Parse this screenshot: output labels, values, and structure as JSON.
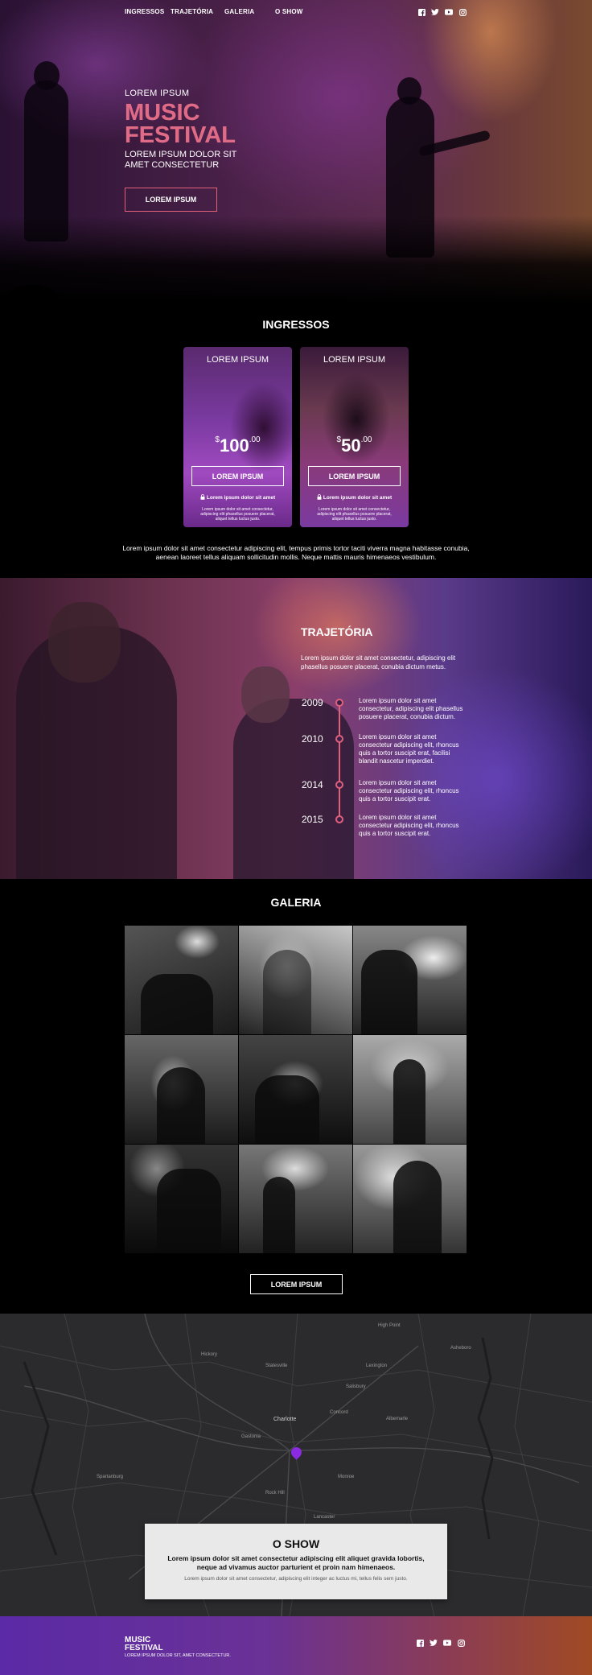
{
  "nav": {
    "items": [
      "INGRESSOS",
      "TRAJETÓRIA",
      "GALERIA",
      "O SHOW"
    ],
    "social_icons": [
      "facebook-icon",
      "twitter-icon",
      "youtube-icon",
      "instagram-icon"
    ]
  },
  "hero": {
    "kicker": "LOREM IPSUM",
    "title_line1": "MUSIC",
    "title_line2": "FESTIVAL",
    "subtitle": "LOREM IPSUM DOLOR SIT AMET CONSECTETUR",
    "button_label": "LOREM IPSUM"
  },
  "tickets": {
    "section_title": "INGRESSOS",
    "items": [
      {
        "title": "LOREM IPSUM",
        "currency": "$",
        "price": "100",
        "cents": ".00",
        "button_label": "LOREM IPSUM",
        "note": "Lorem ipsum dolor sit amet",
        "fine_print": "Lorem ipsum dolor sit amet consectetur, adipiscing elit phasellus posuere placerat, aliquet tellus luctus justo."
      },
      {
        "title": "LOREM IPSUM",
        "currency": "$",
        "price": "50",
        "cents": ".00",
        "button_label": "LOREM IPSUM",
        "note": "Lorem ipsum dolor sit amet",
        "fine_print": "Lorem ipsum dolor sit amet consectetur, adipiscing elit phasellus posuere placerat, aliquet tellus luctus justo."
      }
    ],
    "description": "Lorem ipsum dolor sit amet consectetur adipiscing elit, tempus primis tortor taciti viverra magna habitasse conubia, aenean laoreet tellus aliquam sollicitudin mollis. Neque mattis mauris himenaeos vestibulum."
  },
  "trajetoria": {
    "title": "TRAJETÓRIA",
    "intro": "Lorem ipsum dolor sit amet consectetur, adipiscing elit phasellus posuere placerat, conubia dictum metus.",
    "timeline": [
      {
        "year": "2009",
        "text": "Lorem ipsum dolor sit amet consectetur, adipiscing elit phasellus posuere placerat, conubia dictum."
      },
      {
        "year": "2010",
        "text": "Lorem ipsum dolor sit amet consectetur adipiscing elit, rhoncus quis a tortor suscipit erat, facilisi blandit nascetur imperdiet."
      },
      {
        "year": "2014",
        "text": "Lorem ipsum dolor sit amet consectetur adipiscing elit, rhoncus quis a tortor suscipit erat."
      },
      {
        "year": "2015",
        "text": "Lorem ipsum dolor sit amet consectetur adipiscing elit, rhoncus quis a tortor suscipit erat."
      }
    ]
  },
  "galeria": {
    "title": "GALERIA",
    "button_label": "LOREM IPSUM"
  },
  "map": {
    "places": [
      "Charlotte",
      "High Point",
      "Lexington",
      "Salisbury",
      "Statesville",
      "Gastonia",
      "Rock Hill",
      "Hickory",
      "Albemarle",
      "Concord",
      "Monroe",
      "Lancaster",
      "Asheboro",
      "Spartanburg"
    ]
  },
  "show": {
    "title": "O SHOW",
    "lead": "Lorem ipsum dolor sit amet consectetur adipiscing elit aliquet gravida lobortis, neque ad vivamus auctor parturient et proin nam himenaeos.",
    "fine": "Lorem ipsum dolor sit amet consectetur, adipiscing elit integer ac luctus mi, tellus felis sem justo."
  },
  "footer": {
    "logo_line1": "MUSIC",
    "logo_line2": "FESTIVAL",
    "tagline": "LOREM IPSUM DOLOR SIT, AMET CONSECTETUR.",
    "social_icons": [
      "facebook-icon",
      "twitter-icon",
      "youtube-icon",
      "instagram-icon"
    ]
  },
  "colors": {
    "accent": "#e0607a",
    "footer_start": "#5b2aa6",
    "footer_end": "#a04a24",
    "pin": "#8a2be2"
  }
}
